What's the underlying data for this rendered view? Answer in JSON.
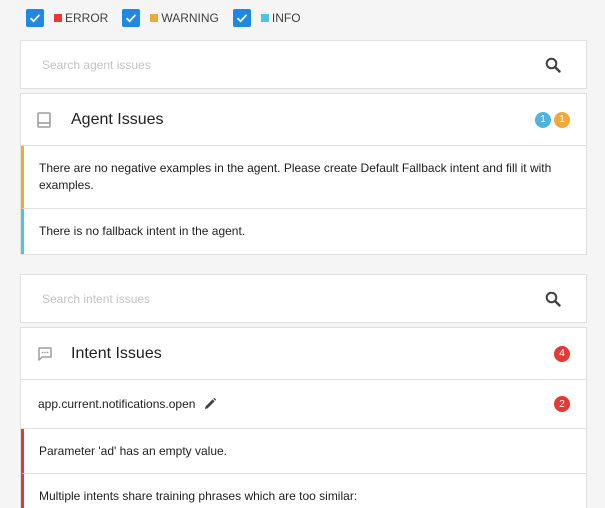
{
  "filters": [
    {
      "label": "ERROR",
      "color": "#e53935",
      "checked": true
    },
    {
      "label": "WARNING",
      "color": "#f2a93b",
      "checked": true
    },
    {
      "label": "INFO",
      "color": "#4fc3e3",
      "checked": true
    }
  ],
  "agent_search": {
    "placeholder": "Search agent issues"
  },
  "agent_issues": {
    "title": "Agent Issues",
    "badges": [
      {
        "count": "1",
        "color": "#4fb3e0"
      },
      {
        "count": "1",
        "color": "#f2a93b"
      }
    ],
    "items": [
      {
        "text": "There are no negative examples in the agent. Please create Default Fallback intent and fill it with examples.",
        "color": "#f2a93b"
      },
      {
        "text": "There is no fallback intent in the agent.",
        "color": "#4fc3e3"
      }
    ]
  },
  "intent_search": {
    "placeholder": "Search intent issues"
  },
  "intent_issues": {
    "title": "Intent Issues",
    "badge": {
      "count": "4",
      "color": "#e53935"
    },
    "intent": {
      "name": "app.current.notifications.open",
      "badge": {
        "count": "2",
        "color": "#e53935"
      }
    },
    "items": [
      {
        "text": "Parameter 'ad' has an empty value.",
        "color": "#e53935"
      },
      {
        "text": "Multiple intents share training phrases which are too similar:",
        "color": "#e53935"
      }
    ]
  },
  "colors": {
    "accent": "#1e88e5",
    "icon_gray": "#9e9e9e"
  }
}
